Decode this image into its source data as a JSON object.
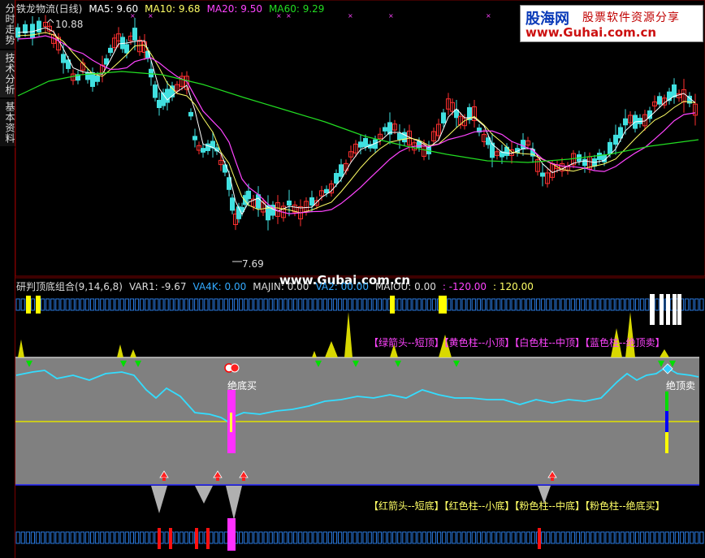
{
  "sidebar": {
    "tab1": "分时走势",
    "tab2": "技术分析",
    "tab3": "基本资料"
  },
  "price_header": {
    "title": "铁龙物流(日线)",
    "ma5": "MA5: 9.60",
    "ma10": "MA10: 9.68",
    "ma20": "MA20: 9.50",
    "ma60": "MA60: 9.29",
    "colors": {
      "ma5": "#ffffff",
      "ma10": "#ffff66",
      "ma20": "#ff44ff",
      "ma60": "#22dd22"
    }
  },
  "price_annotations": {
    "high": "10.88",
    "low": "7.69"
  },
  "logo": {
    "brand": "股海网",
    "slogan": "股票软件资源分享",
    "url": "www.Guhai.com.cn"
  },
  "watermark": "www.Gubai.com.cn",
  "indicator_header": {
    "name": "研判顶底组合(9,14,6,8)",
    "var1": "VAR1: -9.67",
    "va4k": "VA4K: 0.00",
    "majin": "MAJIN: 0.00",
    "va2": "VA2: 00.00",
    "maiou": "MAIOU: 0.00",
    "r1": ": -120.00",
    "r2": ": 120.00"
  },
  "top_legend": "【绿箭头--短顶】【黄色柱--小顶】【白色柱--中顶】【蓝色柱--绝顶卖】",
  "bottom_legend": "【红箭头--短底】【红色柱--小底】【粉色柱--中底】【粉色柱--绝底买】",
  "signals": {
    "buy_label": "绝底买",
    "sell_label": "绝顶卖"
  },
  "chart_data": {
    "type": "line",
    "series": [
      {
        "name": "MA5",
        "values": [
          9.6
        ]
      },
      {
        "name": "MA10",
        "values": [
          9.68
        ]
      },
      {
        "name": "MA20",
        "values": [
          9.5
        ]
      },
      {
        "name": "MA60",
        "values": [
          9.29
        ]
      }
    ],
    "price_high": 10.88,
    "price_low": 7.69
  }
}
